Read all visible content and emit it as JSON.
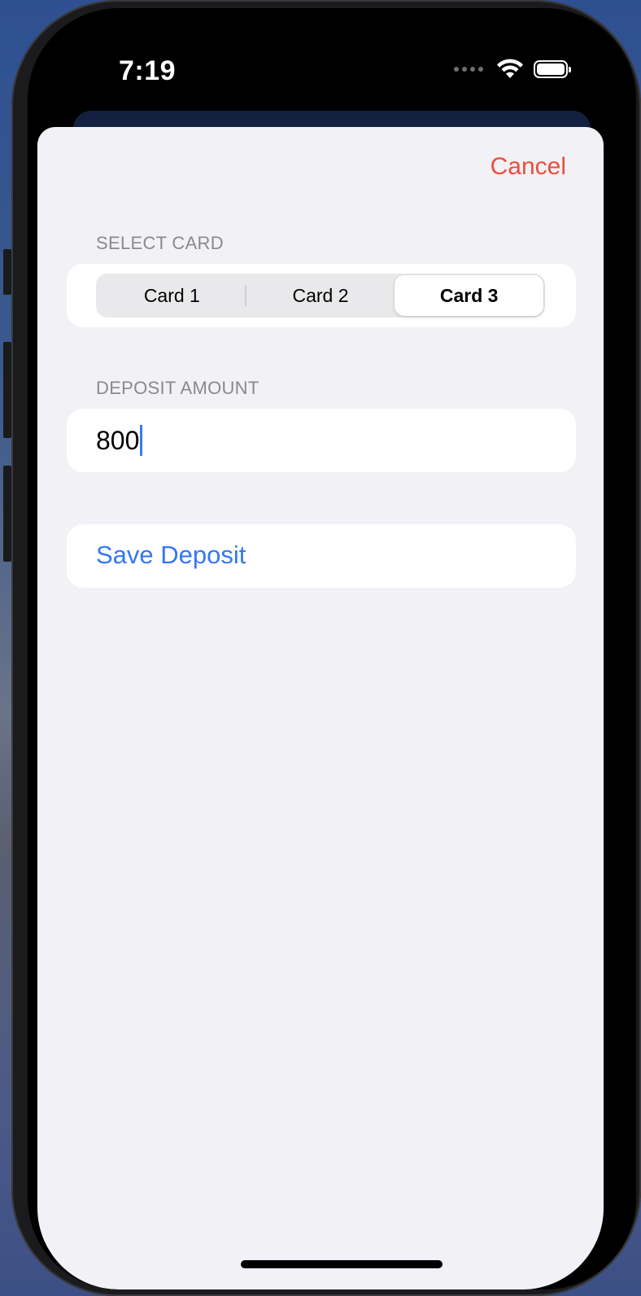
{
  "status_bar": {
    "time": "7:19",
    "icons": [
      "signal-dots-icon",
      "wifi-icon",
      "battery-icon"
    ]
  },
  "sheet": {
    "cancel_label": "Cancel",
    "select_card": {
      "label": "SELECT CARD",
      "options": [
        "Card 1",
        "Card 2",
        "Card 3"
      ],
      "selected": "Card 3"
    },
    "deposit_amount": {
      "label": "DEPOSIT AMOUNT",
      "value": "800"
    },
    "save_label": "Save Deposit"
  },
  "colors": {
    "cancel": "#eb4e3d",
    "accent": "#3478f0",
    "sheet_background": "#f1f1f6"
  }
}
